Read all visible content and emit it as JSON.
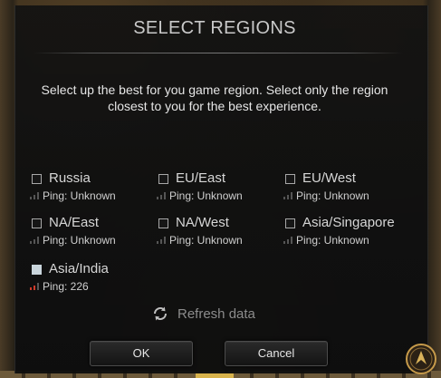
{
  "dialog": {
    "title": "SELECT REGIONS",
    "description": "Select up the best for you game region. Select only the region closest to you for the best experience."
  },
  "regions": [
    {
      "name": "Russia",
      "ping": "Ping: Unknown",
      "checked": false
    },
    {
      "name": "EU/East",
      "ping": "Ping: Unknown",
      "checked": false
    },
    {
      "name": "EU/West",
      "ping": "Ping: Unknown",
      "checked": false
    },
    {
      "name": "NA/East",
      "ping": "Ping: Unknown",
      "checked": false
    },
    {
      "name": "NA/West",
      "ping": "Ping: Unknown",
      "checked": false
    },
    {
      "name": "Asia/Singapore",
      "ping": "Ping: Unknown",
      "checked": false
    },
    {
      "name": "Asia/India",
      "ping": "Ping: 226",
      "checked": true
    }
  ],
  "refresh": {
    "label": "Refresh data",
    "icon": "refresh-icon"
  },
  "buttons": {
    "ok": "OK",
    "cancel": "Cancel"
  },
  "colors": {
    "checked_box": "#c9d5dc",
    "ping_signal_active": "#d03a2a",
    "text": "#d6d6d6",
    "muted_text": "#8c8c8c"
  },
  "icons": {
    "emblem": "game-emblem-icon",
    "signal": "signal-strength-icon",
    "checkbox": "checkbox-icon"
  }
}
